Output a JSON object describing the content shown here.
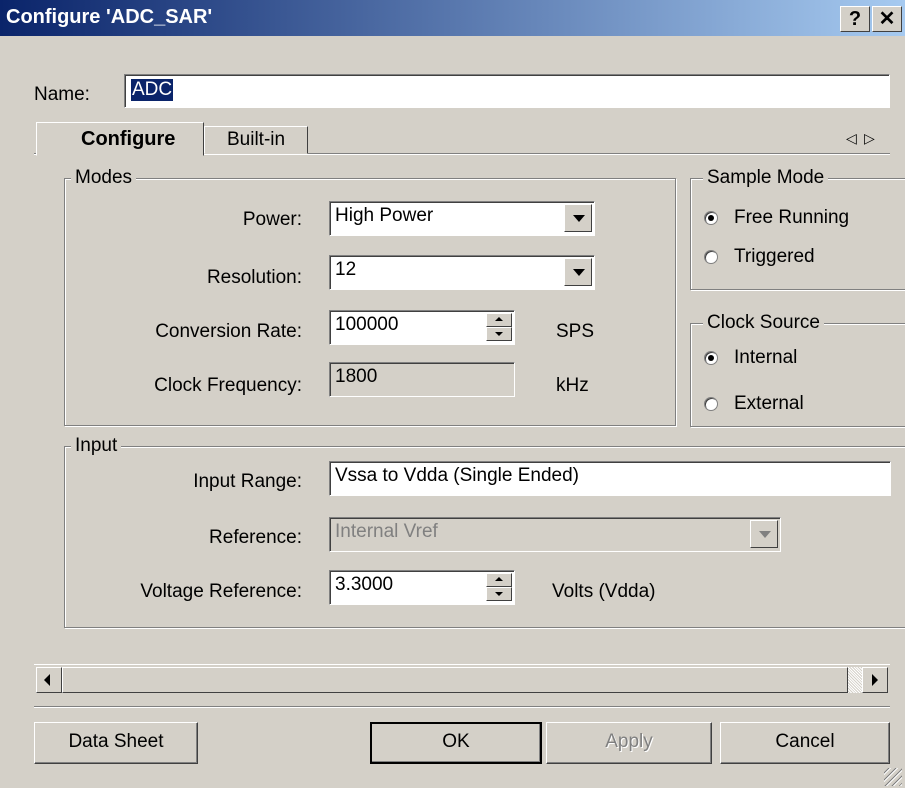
{
  "window": {
    "title": "Configure 'ADC_SAR'",
    "help_label": "?",
    "close_label": "✕"
  },
  "name_row": {
    "label": "Name:",
    "value": "ADC"
  },
  "tabs": [
    {
      "label": "Configure",
      "active": true
    },
    {
      "label": "Built-in",
      "active": false
    }
  ],
  "tab_nav": {
    "left": "◁",
    "right": "▷"
  },
  "modes": {
    "legend": "Modes",
    "power": {
      "label": "Power:",
      "value": "High Power"
    },
    "resolution": {
      "label": "Resolution:",
      "value": "12"
    },
    "conversion_rate": {
      "label": "Conversion Rate:",
      "value": "100000",
      "unit": "SPS"
    },
    "clock_frequency": {
      "label": "Clock Frequency:",
      "value": "1800",
      "unit": "kHz"
    }
  },
  "sample_mode": {
    "legend": "Sample Mode",
    "options": [
      {
        "label": "Free Running",
        "selected": true
      },
      {
        "label": "Triggered",
        "selected": false
      }
    ]
  },
  "clock_source": {
    "legend": "Clock Source",
    "options": [
      {
        "label": "Internal",
        "selected": true
      },
      {
        "label": "External",
        "selected": false
      }
    ]
  },
  "input": {
    "legend": "Input",
    "input_range": {
      "label": "Input Range:",
      "value": "Vssa to Vdda (Single Ended)"
    },
    "reference": {
      "label": "Reference:",
      "value": "Internal Vref"
    },
    "voltage_reference": {
      "label": "Voltage Reference:",
      "value": "3.3000",
      "unit": "Volts (Vdda)"
    }
  },
  "buttons": {
    "data_sheet": "Data Sheet",
    "ok": "OK",
    "apply": "Apply",
    "cancel": "Cancel"
  },
  "colors": {
    "title_start": "#0a246a",
    "title_end": "#a6caf0",
    "face": "#d4d0c8",
    "selection": "#0a246a"
  }
}
